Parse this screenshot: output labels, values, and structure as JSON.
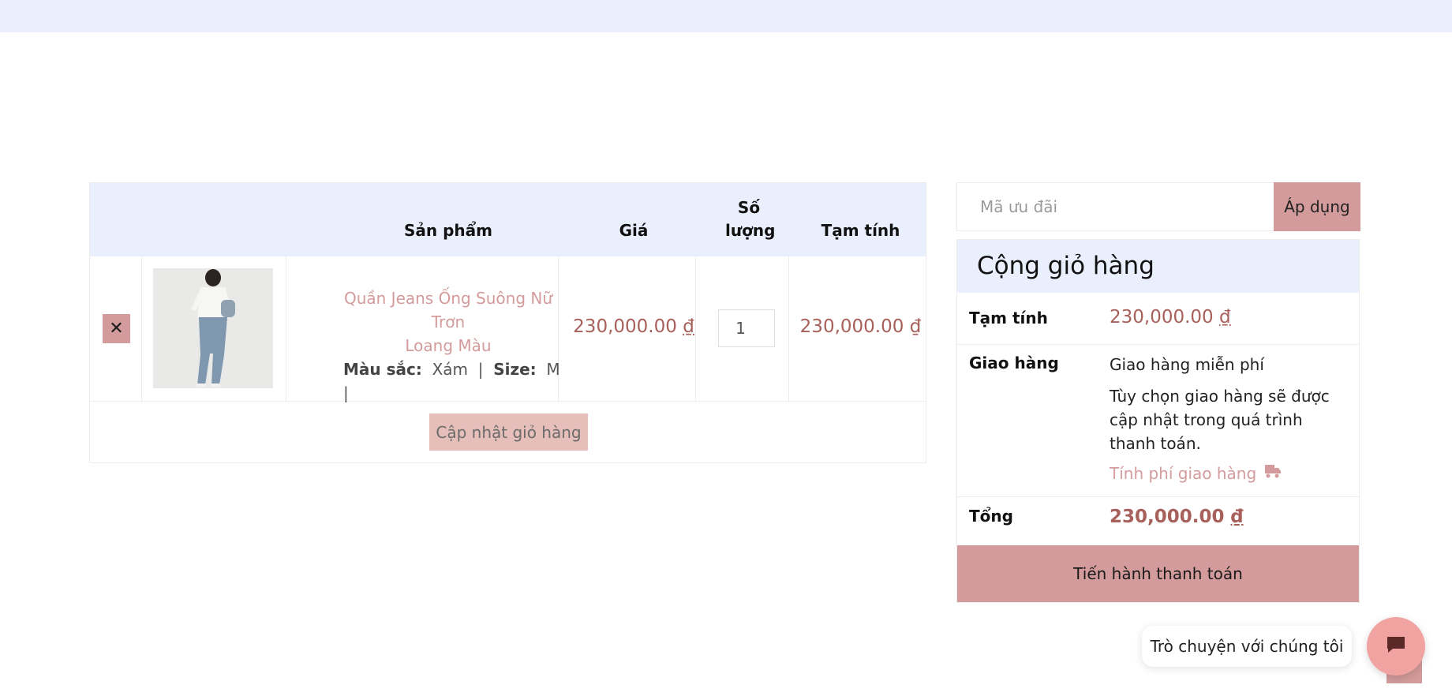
{
  "cart": {
    "headers": {
      "product": "Sản phẩm",
      "price": "Giá",
      "quantity": "Số lượng",
      "subtotal": "Tạm tính"
    },
    "items": [
      {
        "remove_icon": "close-icon",
        "name_line1": "Quần Jeans Ống Suông Nữ Trơn",
        "name_line2": "Loang Màu",
        "color_label": "Màu sắc:",
        "color_value": "Xám",
        "size_label": "Size:",
        "size_value": "M",
        "price": "230,000.00",
        "subtotal": "230,000.00",
        "quantity": "1"
      }
    ],
    "currency_symbol": "₫",
    "update_button": "Cập nhật giỏ hàng"
  },
  "coupon": {
    "placeholder": "Mã ưu đãi",
    "apply_button": "Áp dụng"
  },
  "totals": {
    "title": "Cộng giỏ hàng",
    "subtotal_label": "Tạm tính",
    "subtotal_value": "230,000.00",
    "shipping_label": "Giao hàng",
    "shipping_method": "Giao hàng miễn phí",
    "shipping_note": "Tùy chọn giao hàng sẽ được cập nhật trong quá trình thanh toán.",
    "shipping_calc": "Tính phí giao hàng",
    "total_label": "Tổng",
    "total_value": "230,000.00",
    "checkout_button": "Tiến hành thanh toán"
  },
  "chat": {
    "bubble_text": "Trò chuyện với chúng tôi",
    "icon": "chat-icon"
  },
  "colors": {
    "accent": "#d39b9b",
    "price": "#a8605b",
    "header_bg": "#eaeffe"
  }
}
